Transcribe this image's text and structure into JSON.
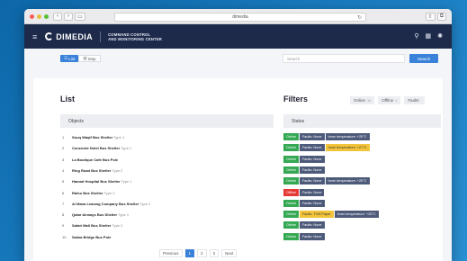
{
  "browser": {
    "url": "dimedia",
    "chrome_buttons": [
      "‹",
      "›",
      "▭"
    ],
    "right_buttons": [
      "⇧",
      "⧉"
    ]
  },
  "header": {
    "logo_text": "DIMEDIA",
    "subtitle_line1": "COMMAND CONTROL",
    "subtitle_line2": "AND MONITORING CENTER"
  },
  "toolbar": {
    "list_label": "List",
    "map_label": "Map",
    "search_placeholder": "Search",
    "search_button": "Search"
  },
  "list_title": "List",
  "filters": {
    "title": "Filters",
    "chips": [
      {
        "label": "Online",
        "count": "10"
      },
      {
        "label": "Offline",
        "count": "1"
      },
      {
        "label": "Faults",
        "count": ""
      }
    ]
  },
  "table": {
    "col_objects": "Objects",
    "col_status": "Status",
    "rows": [
      {
        "num": "1",
        "name": "Souq Waqif Bus Shelter",
        "type": "Type 1",
        "tags": [
          [
            "Online",
            "online"
          ],
          [
            "Faults: None",
            "gray"
          ],
          [
            "Inner temperature: +25°C",
            "gray"
          ]
        ]
      },
      {
        "num": "2",
        "name": "Concorde Hotel Bus Shelter",
        "type": "Type 1",
        "tags": [
          [
            "Online",
            "online"
          ],
          [
            "Faults: None",
            "gray"
          ],
          [
            "Inner temperature: +27°C",
            "yellow"
          ]
        ]
      },
      {
        "num": "3",
        "name": "La Boutique Cafe Bus Pole",
        "type": "",
        "tags": [
          [
            "Online",
            "online"
          ],
          [
            "Faults: None",
            "gray"
          ]
        ]
      },
      {
        "num": "4",
        "name": "Ring Road Bus Shelter",
        "type": "Type 2",
        "tags": [
          [
            "Online",
            "online"
          ],
          [
            "Faults: None",
            "gray"
          ]
        ]
      },
      {
        "num": "5",
        "name": "Hamad Hospital Bus Shelter",
        "type": "Type 1",
        "tags": [
          [
            "Online",
            "online"
          ],
          [
            "Faults: None",
            "gray"
          ],
          [
            "Inner temperature: +25°C",
            "gray"
          ]
        ]
      },
      {
        "num": "6",
        "name": "Rafco Bus Shelter",
        "type": "Type 2",
        "tags": [
          [
            "Offline",
            "offline"
          ],
          [
            "Faults: None",
            "gray"
          ]
        ]
      },
      {
        "num": "7",
        "name": "Al Mana Leasing Company Bus Shelter",
        "type": "Type 2",
        "tags": [
          [
            "Online",
            "online"
          ],
          [
            "Faults: None",
            "gray"
          ]
        ]
      },
      {
        "num": "8",
        "name": "Qatar Airways Bus Shelter",
        "type": "Type 1",
        "tags": [
          [
            "Online",
            "online"
          ],
          [
            "Faults: TVM Paper",
            "yellow"
          ],
          [
            "Inner temperature: +25°C",
            "gray"
          ]
        ]
      },
      {
        "num": "9",
        "name": "Safari Mall Bus Shelter",
        "type": "Type 2",
        "tags": [
          [
            "Online",
            "online"
          ],
          [
            "Faults: None",
            "gray"
          ]
        ]
      },
      {
        "num": "10",
        "name": "Salwa Bridge Bus Pole",
        "type": "",
        "tags": [
          [
            "Online",
            "online"
          ],
          [
            "Faults: None",
            "gray"
          ]
        ]
      }
    ]
  },
  "pagination": {
    "previous": "Previous",
    "pages": [
      "1",
      "2",
      "3"
    ],
    "current": "1",
    "next": "Next"
  },
  "colors": {
    "header_bg": "#1d2a4a",
    "accent": "#3a82d9",
    "online": "#34a853",
    "offline": "#e53935",
    "warning": "#f3c43a"
  }
}
